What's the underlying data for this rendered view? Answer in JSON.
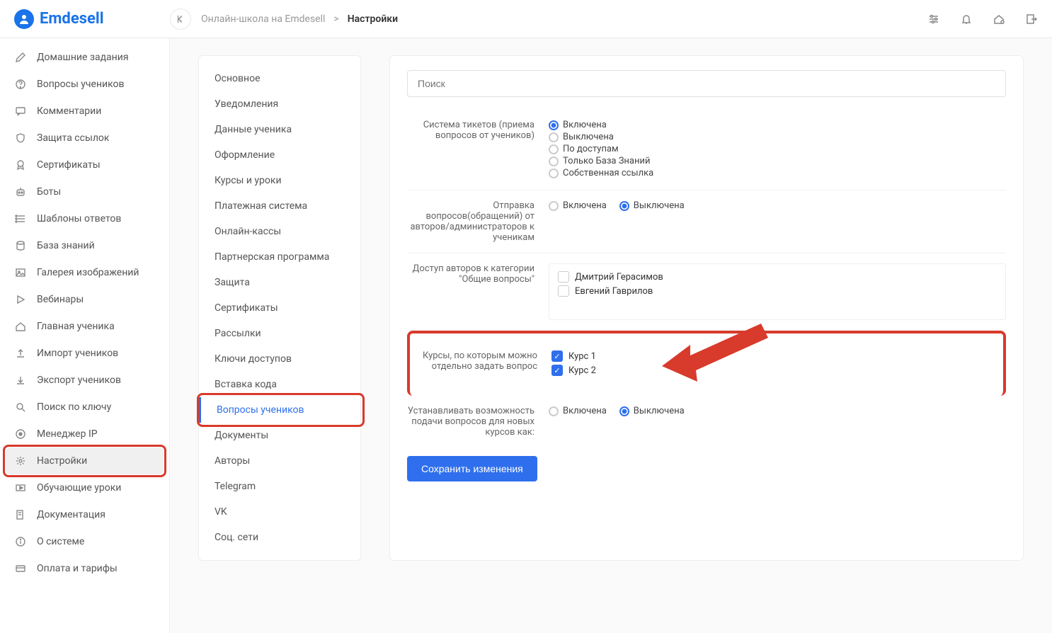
{
  "brand": "Emdesell",
  "breadcrumb": {
    "root": "Онлайн-школа на Emdesell",
    "sep": ">",
    "current": "Настройки"
  },
  "search": {
    "placeholder": "Поиск"
  },
  "sidebar": [
    {
      "icon": "pencil",
      "label": "Домашние задания"
    },
    {
      "icon": "help",
      "label": "Вопросы учеников"
    },
    {
      "icon": "chat",
      "label": "Комментарии"
    },
    {
      "icon": "shield",
      "label": "Защита ссылок"
    },
    {
      "icon": "badge",
      "label": "Сертификаты"
    },
    {
      "icon": "bot",
      "label": "Боты"
    },
    {
      "icon": "list",
      "label": "Шаблоны ответов"
    },
    {
      "icon": "db",
      "label": "База знаний"
    },
    {
      "icon": "image",
      "label": "Галерея изображений"
    },
    {
      "icon": "play",
      "label": "Вебинары"
    },
    {
      "icon": "home",
      "label": "Главная ученика"
    },
    {
      "icon": "upload",
      "label": "Импорт учеников"
    },
    {
      "icon": "download",
      "label": "Экспорт учеников"
    },
    {
      "icon": "search",
      "label": "Поиск по ключу"
    },
    {
      "icon": "ip",
      "label": "Менеджер IP"
    },
    {
      "icon": "gear",
      "label": "Настройки",
      "active": true
    },
    {
      "icon": "video",
      "label": "Обучающие уроки"
    },
    {
      "icon": "doc",
      "label": "Документация"
    },
    {
      "icon": "info",
      "label": "О системе"
    },
    {
      "icon": "card",
      "label": "Оплата и тарифы"
    }
  ],
  "subnav": [
    "Основное",
    "Уведомления",
    "Данные ученика",
    "Оформление",
    "Курсы и уроки",
    "Платежная система",
    "Онлайн-кассы",
    "Партнерская программа",
    "Защита",
    "Сертификаты",
    "Рассылки",
    "Ключи доступов",
    "Вставка кода",
    "Вопросы учеников",
    "Документы",
    "Авторы",
    "Telegram",
    "VK",
    "Соц. сети"
  ],
  "subnavActive": 13,
  "rows": {
    "tickets": {
      "label": "Система тикетов (приема вопросов от учеников)",
      "options": [
        "Включена",
        "Выключена",
        "По доступам",
        "Только База Знаний",
        "Собственная ссылка"
      ],
      "selected": 0
    },
    "send": {
      "label": "Отправка вопросов(обращений) от авторов/администраторов к ученикам",
      "options": [
        "Включена",
        "Выключена"
      ],
      "selected": 1
    },
    "authors": {
      "label": "Доступ авторов к категории \"Общие вопросы\"",
      "items": [
        {
          "label": "Дмитрий Герасимов",
          "checked": false
        },
        {
          "label": "Евгений Гаврилов",
          "checked": false
        }
      ]
    },
    "courses": {
      "label": "Курсы, по которым можно отдельно задать вопрос",
      "items": [
        {
          "label": "Курс 1",
          "checked": true
        },
        {
          "label": "Курс 2",
          "checked": true
        }
      ]
    },
    "newcourses": {
      "label": "Устанавливать возможность подачи вопросов для новых курсов как:",
      "options": [
        "Включена",
        "Выключена"
      ],
      "selected": 1
    }
  },
  "saveLabel": "Сохранить изменения"
}
